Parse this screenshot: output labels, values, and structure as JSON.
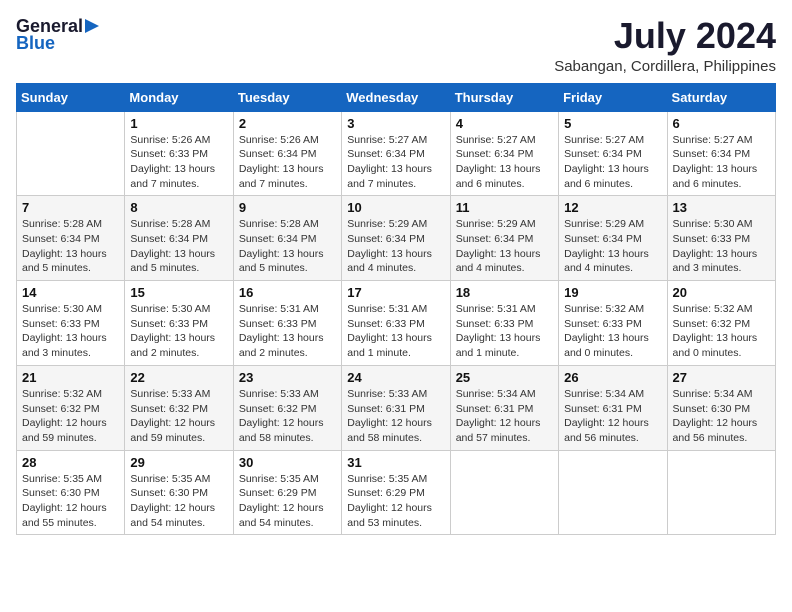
{
  "header": {
    "logo_line1": "General",
    "logo_line2": "Blue",
    "month_year": "July 2024",
    "location": "Sabangan, Cordillera, Philippines"
  },
  "days_of_week": [
    "Sunday",
    "Monday",
    "Tuesday",
    "Wednesday",
    "Thursday",
    "Friday",
    "Saturday"
  ],
  "weeks": [
    [
      {
        "day": "",
        "info": ""
      },
      {
        "day": "1",
        "info": "Sunrise: 5:26 AM\nSunset: 6:33 PM\nDaylight: 13 hours\nand 7 minutes."
      },
      {
        "day": "2",
        "info": "Sunrise: 5:26 AM\nSunset: 6:34 PM\nDaylight: 13 hours\nand 7 minutes."
      },
      {
        "day": "3",
        "info": "Sunrise: 5:27 AM\nSunset: 6:34 PM\nDaylight: 13 hours\nand 7 minutes."
      },
      {
        "day": "4",
        "info": "Sunrise: 5:27 AM\nSunset: 6:34 PM\nDaylight: 13 hours\nand 6 minutes."
      },
      {
        "day": "5",
        "info": "Sunrise: 5:27 AM\nSunset: 6:34 PM\nDaylight: 13 hours\nand 6 minutes."
      },
      {
        "day": "6",
        "info": "Sunrise: 5:27 AM\nSunset: 6:34 PM\nDaylight: 13 hours\nand 6 minutes."
      }
    ],
    [
      {
        "day": "7",
        "info": "Sunrise: 5:28 AM\nSunset: 6:34 PM\nDaylight: 13 hours\nand 5 minutes."
      },
      {
        "day": "8",
        "info": "Sunrise: 5:28 AM\nSunset: 6:34 PM\nDaylight: 13 hours\nand 5 minutes."
      },
      {
        "day": "9",
        "info": "Sunrise: 5:28 AM\nSunset: 6:34 PM\nDaylight: 13 hours\nand 5 minutes."
      },
      {
        "day": "10",
        "info": "Sunrise: 5:29 AM\nSunset: 6:34 PM\nDaylight: 13 hours\nand 4 minutes."
      },
      {
        "day": "11",
        "info": "Sunrise: 5:29 AM\nSunset: 6:34 PM\nDaylight: 13 hours\nand 4 minutes."
      },
      {
        "day": "12",
        "info": "Sunrise: 5:29 AM\nSunset: 6:34 PM\nDaylight: 13 hours\nand 4 minutes."
      },
      {
        "day": "13",
        "info": "Sunrise: 5:30 AM\nSunset: 6:33 PM\nDaylight: 13 hours\nand 3 minutes."
      }
    ],
    [
      {
        "day": "14",
        "info": "Sunrise: 5:30 AM\nSunset: 6:33 PM\nDaylight: 13 hours\nand 3 minutes."
      },
      {
        "day": "15",
        "info": "Sunrise: 5:30 AM\nSunset: 6:33 PM\nDaylight: 13 hours\nand 2 minutes."
      },
      {
        "day": "16",
        "info": "Sunrise: 5:31 AM\nSunset: 6:33 PM\nDaylight: 13 hours\nand 2 minutes."
      },
      {
        "day": "17",
        "info": "Sunrise: 5:31 AM\nSunset: 6:33 PM\nDaylight: 13 hours\nand 1 minute."
      },
      {
        "day": "18",
        "info": "Sunrise: 5:31 AM\nSunset: 6:33 PM\nDaylight: 13 hours\nand 1 minute."
      },
      {
        "day": "19",
        "info": "Sunrise: 5:32 AM\nSunset: 6:33 PM\nDaylight: 13 hours\nand 0 minutes."
      },
      {
        "day": "20",
        "info": "Sunrise: 5:32 AM\nSunset: 6:32 PM\nDaylight: 13 hours\nand 0 minutes."
      }
    ],
    [
      {
        "day": "21",
        "info": "Sunrise: 5:32 AM\nSunset: 6:32 PM\nDaylight: 12 hours\nand 59 minutes."
      },
      {
        "day": "22",
        "info": "Sunrise: 5:33 AM\nSunset: 6:32 PM\nDaylight: 12 hours\nand 59 minutes."
      },
      {
        "day": "23",
        "info": "Sunrise: 5:33 AM\nSunset: 6:32 PM\nDaylight: 12 hours\nand 58 minutes."
      },
      {
        "day": "24",
        "info": "Sunrise: 5:33 AM\nSunset: 6:31 PM\nDaylight: 12 hours\nand 58 minutes."
      },
      {
        "day": "25",
        "info": "Sunrise: 5:34 AM\nSunset: 6:31 PM\nDaylight: 12 hours\nand 57 minutes."
      },
      {
        "day": "26",
        "info": "Sunrise: 5:34 AM\nSunset: 6:31 PM\nDaylight: 12 hours\nand 56 minutes."
      },
      {
        "day": "27",
        "info": "Sunrise: 5:34 AM\nSunset: 6:30 PM\nDaylight: 12 hours\nand 56 minutes."
      }
    ],
    [
      {
        "day": "28",
        "info": "Sunrise: 5:35 AM\nSunset: 6:30 PM\nDaylight: 12 hours\nand 55 minutes."
      },
      {
        "day": "29",
        "info": "Sunrise: 5:35 AM\nSunset: 6:30 PM\nDaylight: 12 hours\nand 54 minutes."
      },
      {
        "day": "30",
        "info": "Sunrise: 5:35 AM\nSunset: 6:29 PM\nDaylight: 12 hours\nand 54 minutes."
      },
      {
        "day": "31",
        "info": "Sunrise: 5:35 AM\nSunset: 6:29 PM\nDaylight: 12 hours\nand 53 minutes."
      },
      {
        "day": "",
        "info": ""
      },
      {
        "day": "",
        "info": ""
      },
      {
        "day": "",
        "info": ""
      }
    ]
  ]
}
